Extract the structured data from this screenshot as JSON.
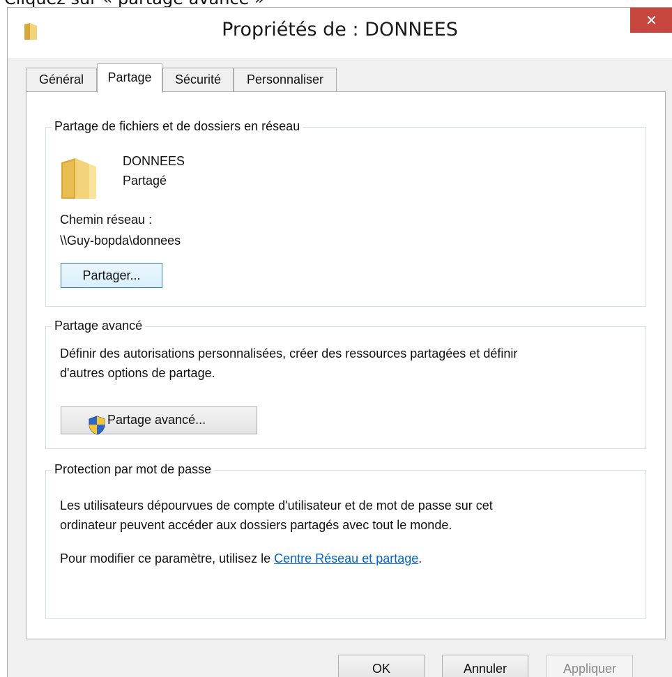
{
  "top_cut_text": "Cliquez sur « partage avancé »",
  "window": {
    "title": "Propriétés de : DONNEES",
    "close_label": "✕"
  },
  "tabs": [
    {
      "label": "Général",
      "active": false
    },
    {
      "label": "Partage",
      "active": true
    },
    {
      "label": "Sécurité",
      "active": false
    },
    {
      "label": "Personnaliser",
      "active": false
    }
  ],
  "network_sharing": {
    "title": "Partage de fichiers et de dossiers en réseau",
    "folder_name": "DONNEES",
    "status": "Partagé",
    "path_label": "Chemin réseau :",
    "path_value": "\\\\Guy-bopda\\donnees",
    "share_button": "Partager..."
  },
  "advanced_sharing": {
    "title": "Partage avancé",
    "description_line1": "Définir des autorisations personnalisées, créer des ressources partagées et définir",
    "description_line2": "d'autres options de partage.",
    "button": "Partage avancé..."
  },
  "password_protection": {
    "title": "Protection par mot de passe",
    "description_line1": "Les utilisateurs dépourvues de compte d'utilisateur et de mot de passe sur cet",
    "description_line2": "ordinateur peuvent accéder aux dossiers partagés avec tout le monde.",
    "modify_prefix": "Pour modifier ce paramètre, utilisez le ",
    "modify_link": "Centre Réseau et partage",
    "modify_suffix": "."
  },
  "footer": {
    "ok": "OK",
    "cancel": "Annuler",
    "apply": "Appliquer"
  },
  "colors": {
    "close_button": "#c7463e",
    "link": "#0066cc",
    "folder": "#e8c25b"
  }
}
